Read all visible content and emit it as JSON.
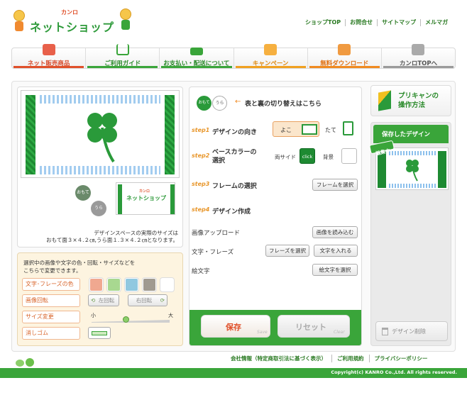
{
  "header": {
    "brand": "カンロ",
    "logo": "ネットショップ",
    "top_links": [
      "ショップTOP",
      "お問合せ",
      "サイトマップ",
      "メルマガ"
    ]
  },
  "nav": [
    {
      "label": "ネット販売商品",
      "color": "#e0502a"
    },
    {
      "label": "ご利用ガイド",
      "color": "#3aa53a"
    },
    {
      "label": "お支払い・配送について",
      "color": "#3aa53a"
    },
    {
      "label": "キャンペーン",
      "color": "#f0a020"
    },
    {
      "label": "無料ダウンロード",
      "color": "#f08a20"
    },
    {
      "label": "カンロTOPへ",
      "color": "#9a9a9a"
    }
  ],
  "preview": {
    "front_label": "おもて",
    "back_label": "うら",
    "note_line1": "デザインスペースの実際のサイズは",
    "note_line2": "おもて面３×４.２㎝,うら面１.３×４.２㎝となります。",
    "mini_brand": "カンロ",
    "mini_logo": "ネットショップ"
  },
  "controls": {
    "intro_line1": "選択中の画像や文字の色・回転・サイズなどを",
    "intro_line2": "こちらで変更できます。",
    "color_label": "文字･フレーズの色",
    "rotate_label": "画像回転",
    "rotate_left": "左回転",
    "rotate_right": "右回転",
    "size_label": "サイズ変更",
    "size_small": "小",
    "size_large": "大",
    "eraser_label": "消しゴム",
    "swatches": [
      "#f0a890",
      "#a8d890",
      "#90c8e0",
      "#a09a90",
      "#ffffff"
    ]
  },
  "steps": {
    "toggle_front": "おもて",
    "toggle_back": "うら",
    "toggle_hint": "表と裏の切り替えはこちら",
    "step1_badge": "step1",
    "step1": "デザインの向き",
    "yoko": "よこ",
    "tate": "たて",
    "step2_badge": "step2",
    "step2_line1": "ベースカラーの",
    "step2_line2": "選択",
    "both_sides": "両サイド",
    "click": "click",
    "background": "背景",
    "step3_badge": "step3",
    "step3": "フレームの選択",
    "frame_button": "フレームを選択",
    "step4_badge": "step4",
    "step4": "デザイン作成",
    "image_upload": "画像アップロード",
    "image_button": "画像を読み込む",
    "text_phrase": "文字・フレーズ",
    "phrase_button": "フレーズを選択",
    "text_button": "文字を入れる",
    "emoji": "絵文字",
    "emoji_button": "絵文字を選択",
    "save": "保存",
    "save_sub": "Save",
    "reset": "リセット",
    "reset_sub": "Clear"
  },
  "sidebar": {
    "howto_line1": "プリキャンの",
    "howto_line2": "操作方法",
    "saved_title": "保存したデザイン",
    "editing_badge": "編集中",
    "delete": "デザイン削除"
  },
  "footer": {
    "links": [
      "会社情報（特定商取引法に基づく表示）",
      "ご利用規約",
      "プライバシーポリシー"
    ],
    "copyright": "Copyright(c) KANRO Co.,Ltd. All rights reserved."
  }
}
